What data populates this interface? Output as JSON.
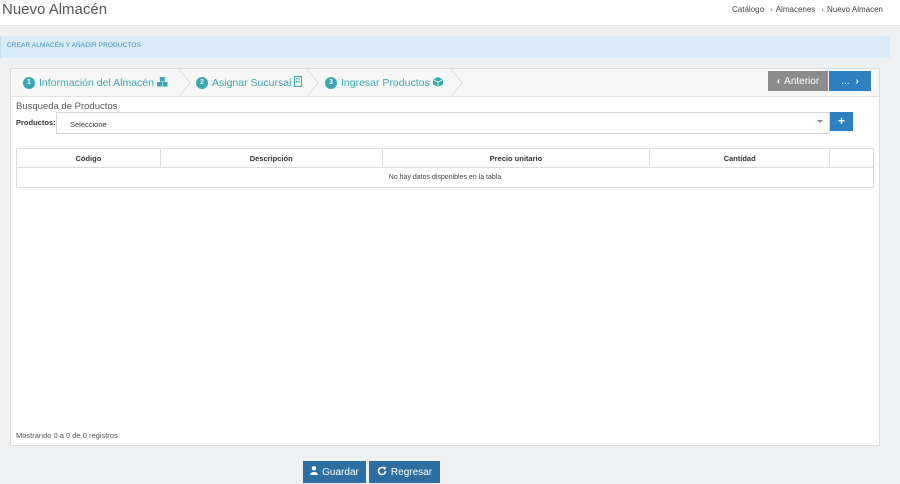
{
  "header": {
    "title": "Nuevo Almacén",
    "breadcrumb": [
      "Catálogo",
      "Almacenes",
      "Nuevo Almacen"
    ]
  },
  "section": {
    "title": "CREAR ALMACÉN Y AÑADIR PRODUCTOS"
  },
  "steps": [
    {
      "num": "1",
      "label": "Información del Almacén",
      "icon": "cubes-icon"
    },
    {
      "num": "2",
      "label": "Asignar Sucursal",
      "icon": "building-icon"
    },
    {
      "num": "3",
      "label": "Ingresar Productos",
      "icon": "cube-icon"
    }
  ],
  "nav": {
    "prev_label": "Anterior",
    "next_label": "..."
  },
  "search": {
    "title": "Busqueda de Productos",
    "label": "Productos:",
    "selected": "Seleccione"
  },
  "table": {
    "columns": [
      "Código",
      "Descripción",
      "Precio unitario",
      "Cantidad",
      ""
    ],
    "empty_message": "No hay datos disponibles en la tabla",
    "info": "Mostrando 0 a 0 de 0 registros"
  },
  "actions": {
    "save_label": "Guardar",
    "back_label": "Regresar"
  },
  "colors": {
    "primary": "#2f80c0",
    "step": "#3aa6b0",
    "secondary": "#8c8c8c"
  }
}
